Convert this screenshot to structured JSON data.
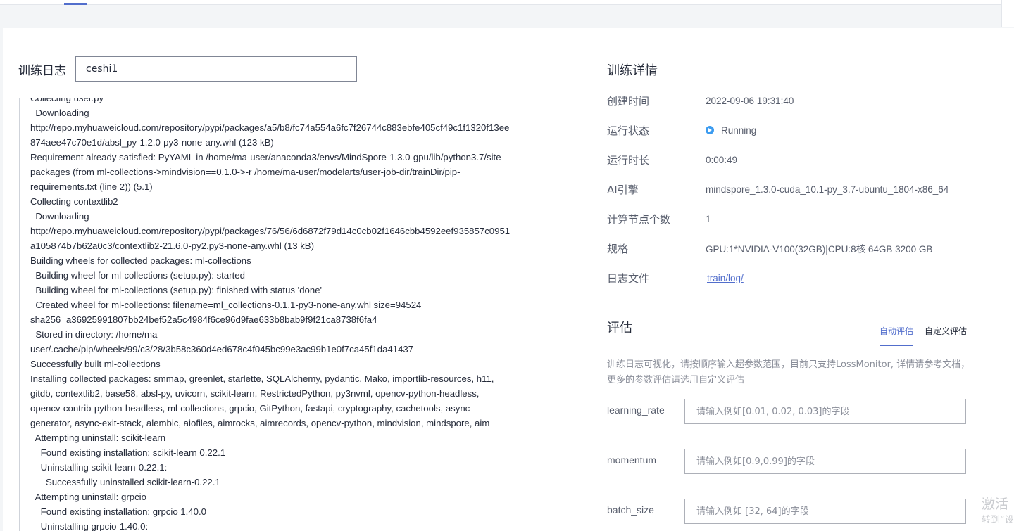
{
  "log": {
    "title": "训练日志",
    "selected_job": "ceshi1",
    "lines": [
      "Collecting user.py",
      "  Downloading",
      "http://repo.myhuaweicloud.com/repository/pypi/packages/a5/b8/fc74a554a6fc7f26744c883ebfe405cf49c1f1320f13ee",
      "874aee47c70e1d/absl_py-1.2.0-py3-none-any.whl (123 kB)",
      "Requirement already satisfied: PyYAML in /home/ma-user/anaconda3/envs/MindSpore-1.3.0-gpu/lib/python3.7/site-",
      "packages (from ml-collections->mindvision==0.1.0->-r /home/ma-user/modelarts/user-job-dir/trainDir/pip-",
      "requirements.txt (line 2)) (5.1)",
      "Collecting contextlib2",
      "  Downloading",
      "http://repo.myhuaweicloud.com/repository/pypi/packages/76/56/6d6872f79d14c0cb02f1646cbb4592eef935857c0951",
      "a105874b7b62a0c3/contextlib2-21.6.0-py2.py3-none-any.whl (13 kB)",
      "Building wheels for collected packages: ml-collections",
      "  Building wheel for ml-collections (setup.py): started",
      "  Building wheel for ml-collections (setup.py): finished with status 'done'",
      "  Created wheel for ml-collections: filename=ml_collections-0.1.1-py3-none-any.whl size=94524",
      "sha256=a36925991807bb24bef52a5c4984f6ce96d9fae633b8bab9f9f21ca8738f6fa4",
      "  Stored in directory: /home/ma-",
      "user/.cache/pip/wheels/99/c3/28/3b58c360d4ed678c4f045bc99e3ac99b1e0f7ca45f1da41437",
      "Successfully built ml-collections",
      "Installing collected packages: smmap, greenlet, starlette, SQLAlchemy, pydantic, Mako, importlib-resources, h11,",
      "gitdb, contextlib2, base58, absl-py, uvicorn, scikit-learn, RestrictedPython, py3nvml, opencv-python-headless,",
      "opencv-contrib-python-headless, ml-collections, grpcio, GitPython, fastapi, cryptography, cachetools, async-",
      "generator, async-exit-stack, alembic, aiofiles, aimrocks, aimrecords, opencv-python, mindvision, mindspore, aim",
      "  Attempting uninstall: scikit-learn",
      "    Found existing installation: scikit-learn 0.22.1",
      "    Uninstalling scikit-learn-0.22.1:",
      "      Successfully uninstalled scikit-learn-0.22.1",
      "  Attempting uninstall: grpcio",
      "    Found existing installation: grpcio 1.40.0",
      "    Uninstalling grpcio-1.40.0:"
    ]
  },
  "details": {
    "title": "训练详情",
    "created_label": "创建时间",
    "created_value": "2022-09-06 19:31:40",
    "status_label": "运行状态",
    "status_value": "Running",
    "duration_label": "运行时长",
    "duration_value": "0:00:49",
    "engine_label": "AI引擎",
    "engine_value": "mindspore_1.3.0-cuda_10.1-py_3.7-ubuntu_1804-x86_64",
    "nodes_label": "计算节点个数",
    "nodes_value": "1",
    "spec_label": "规格",
    "spec_value": "GPU:1*NVIDIA-V100(32GB)|CPU:8核 64GB 3200 GB",
    "logfile_label": "日志文件",
    "logfile_value": "train/log/"
  },
  "evaluation": {
    "title": "评估",
    "tabs": [
      "自动评估",
      "自定义评估"
    ],
    "active_tab": "自动评估",
    "description": "训练日志可视化，请按顺序输入超参数范围，目前只支持LossMonitor, 详情请参考文档，更多的参数评估请选用自定义评估",
    "params": [
      {
        "label": "learning_rate",
        "placeholder": "请输入例如[0.01, 0.02, 0.03]的字段",
        "value": ""
      },
      {
        "label": "momentum",
        "placeholder": "请输入例如[0.9,0.99]的字段",
        "value": ""
      },
      {
        "label": "batch_size",
        "placeholder": "请输入例如 [32, 64]的字段",
        "value": ""
      }
    ]
  },
  "watermark": {
    "line1": "激活",
    "line2": "转到“设"
  },
  "colors": {
    "accent": "#526ecc",
    "status_running": "#3c9cf0"
  }
}
